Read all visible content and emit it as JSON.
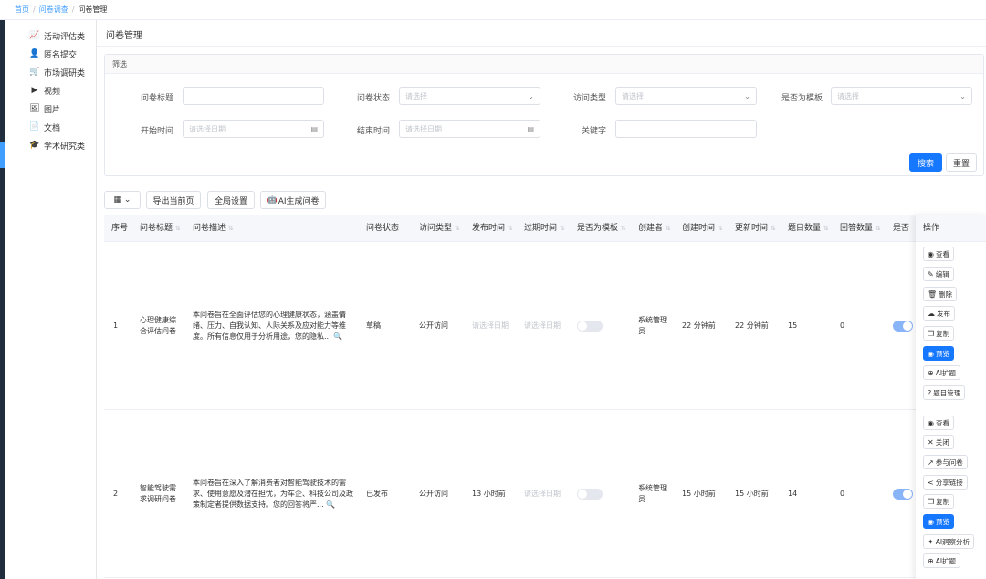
{
  "breadcrumb": {
    "home": "首页",
    "survey": "问卷调查",
    "current": "问卷管理"
  },
  "sidebar": {
    "items": [
      {
        "icon": "📈",
        "label": "活动评估类"
      },
      {
        "icon": "👤",
        "label": "匿名提交"
      },
      {
        "icon": "🛒",
        "label": "市场调研类"
      },
      {
        "icon": "▶",
        "label": "视频"
      },
      {
        "icon": "🖼",
        "label": "图片"
      },
      {
        "icon": "📄",
        "label": "文档"
      },
      {
        "icon": "🎓",
        "label": "学术研究类"
      }
    ]
  },
  "page_title": "问卷管理",
  "filter": {
    "header": "筛选",
    "title_label": "问卷标题",
    "status_label": "问卷状态",
    "status_placeholder": "请选择",
    "access_label": "访问类型",
    "access_placeholder": "请选择",
    "template_label": "是否为模板",
    "template_placeholder": "请选择",
    "start_label": "开始时间",
    "start_placeholder": "请选择日期",
    "end_label": "结束时间",
    "end_placeholder": "请选择日期",
    "keyword_label": "关键字",
    "search_button": "搜索",
    "reset_button": "重置"
  },
  "toolbar": {
    "grid_icon": "▦ ⌄",
    "export": "导出当前页",
    "global": "全局设置",
    "ai": "AI生成问卷"
  },
  "table": {
    "headers": [
      "序号",
      "问卷标题",
      "问卷描述",
      "问卷状态",
      "访问类型",
      "发布时间",
      "过期时间",
      "是否为模板",
      "创建者",
      "创建时间",
      "更新时间",
      "题目数量",
      "回答数量",
      "是否"
    ],
    "ops_header": "操作",
    "rows": [
      {
        "index": "1",
        "title": "心理健康综合评估问卷",
        "desc": "本问卷旨在全面评估您的心理健康状态，涵盖情绪、压力、自我认知、人际关系及应对能力等维度。所有信息仅用于分析用途，您的隐私... 🔍",
        "status": "草稿",
        "access": "公开访问",
        "publish": "请选择日期",
        "expire": "请选择日期",
        "creator": "系统管理员",
        "created": "22 分钟前",
        "updated": "22 分钟前",
        "questions": "15",
        "answers": "0",
        "ops": [
          {
            "icon": "◉",
            "label": "查看"
          },
          {
            "icon": "✎",
            "label": "编辑"
          },
          {
            "icon": "🗑",
            "label": "删除"
          },
          {
            "icon": "☁",
            "label": "发布"
          },
          {
            "icon": "❐",
            "label": "复制"
          },
          {
            "icon": "◉",
            "label": "预览",
            "primary": true
          },
          {
            "icon": "⊕",
            "label": "AI扩题"
          },
          {
            "icon": "?",
            "label": "题目管理"
          }
        ]
      },
      {
        "index": "2",
        "title": "智能驾驶需求调研问卷",
        "desc": "本问卷旨在深入了解消费者对智能驾驶技术的需求、使用意愿及潜在担忧，为车企、科技公司及政策制定者提供数据支持。您的回答将严... 🔍",
        "status": "已发布",
        "access": "公开访问",
        "publish": "13 小时前",
        "expire": "请选择日期",
        "creator": "系统管理员",
        "created": "15 小时前",
        "updated": "15 小时前",
        "questions": "14",
        "answers": "0",
        "ops": [
          {
            "icon": "◉",
            "label": "查看"
          },
          {
            "icon": "✕",
            "label": "关闭"
          },
          {
            "icon": "↗",
            "label": "参与问卷"
          },
          {
            "icon": "<",
            "label": "分享链接"
          },
          {
            "icon": "❐",
            "label": "复制"
          },
          {
            "icon": "◉",
            "label": "预览",
            "primary": true
          },
          {
            "icon": "✦",
            "label": "AI洞察分析"
          },
          {
            "icon": "⊕",
            "label": "AI扩题"
          }
        ]
      }
    ]
  }
}
